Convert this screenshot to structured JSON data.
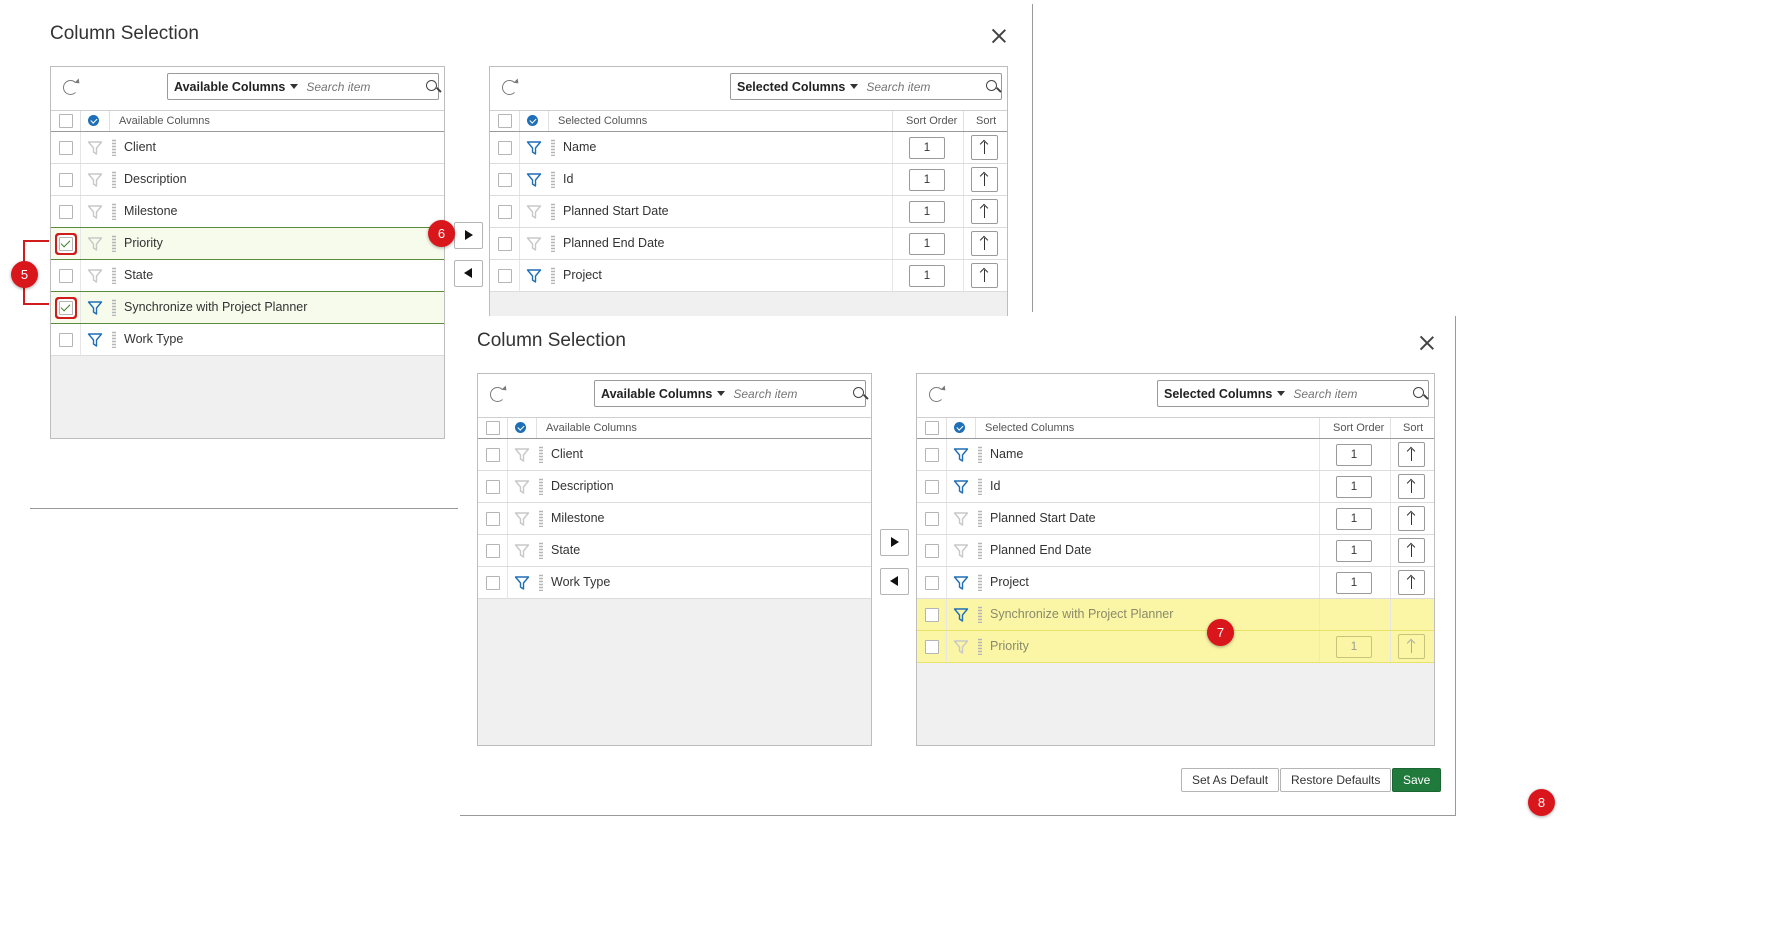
{
  "dialog_before": {
    "title": "Column Selection",
    "available": {
      "dropdown_label": "Available Columns",
      "search_placeholder": "Search item",
      "header": "Available Columns",
      "rows": [
        {
          "label": "Client",
          "checked": false,
          "filter": false
        },
        {
          "label": "Description",
          "checked": false,
          "filter": false
        },
        {
          "label": "Milestone",
          "checked": false,
          "filter": false
        },
        {
          "label": "Priority",
          "checked": true,
          "filter": false
        },
        {
          "label": "State",
          "checked": false,
          "filter": false
        },
        {
          "label": "Synchronize with Project Planner",
          "checked": true,
          "filter": true
        },
        {
          "label": "Work Type",
          "checked": false,
          "filter": true
        }
      ]
    },
    "selected": {
      "dropdown_label": "Selected Columns",
      "search_placeholder": "Search item",
      "header": "Selected Columns",
      "sort_order_header": "Sort Order",
      "sort_header": "Sort",
      "rows": [
        {
          "label": "Name",
          "order": "1",
          "filter": true
        },
        {
          "label": "Id",
          "order": "1",
          "filter": true
        },
        {
          "label": "Planned Start Date",
          "order": "1",
          "filter": false
        },
        {
          "label": "Planned End Date",
          "order": "1",
          "filter": false
        },
        {
          "label": "Project",
          "order": "1",
          "filter": true
        }
      ]
    }
  },
  "dialog_after": {
    "title": "Column Selection",
    "available": {
      "dropdown_label": "Available Columns",
      "search_placeholder": "Search item",
      "header": "Available Columns",
      "rows": [
        {
          "label": "Client",
          "filter": false
        },
        {
          "label": "Description",
          "filter": false
        },
        {
          "label": "Milestone",
          "filter": false
        },
        {
          "label": "State",
          "filter": false
        },
        {
          "label": "Work Type",
          "filter": true
        }
      ]
    },
    "selected": {
      "dropdown_label": "Selected Columns",
      "search_placeholder": "Search item",
      "header": "Selected Columns",
      "sort_order_header": "Sort Order",
      "sort_header": "Sort",
      "rows": [
        {
          "label": "Name",
          "order": "1",
          "filter": true,
          "highlight": false
        },
        {
          "label": "Id",
          "order": "1",
          "filter": true,
          "highlight": false
        },
        {
          "label": "Planned Start Date",
          "order": "1",
          "filter": false,
          "highlight": false
        },
        {
          "label": "Planned End Date",
          "order": "1",
          "filter": false,
          "highlight": false
        },
        {
          "label": "Project",
          "order": "1",
          "filter": true,
          "highlight": false
        },
        {
          "label": "Synchronize with Project Planner",
          "order": "",
          "filter": true,
          "highlight": true
        },
        {
          "label": "Priority",
          "order": "1",
          "filter": false,
          "highlight": true
        }
      ]
    },
    "footer": {
      "set_default": "Set As Default",
      "restore_defaults": "Restore Defaults",
      "save": "Save"
    }
  },
  "badges": {
    "b5": "5",
    "b6": "6",
    "b7": "7",
    "b8": "8"
  },
  "colors": {
    "accent_blue": "#1f6fb6",
    "callout_red": "#d9161b",
    "save_green": "#207a3c",
    "highlight_yellow": "#fbf6a6"
  }
}
